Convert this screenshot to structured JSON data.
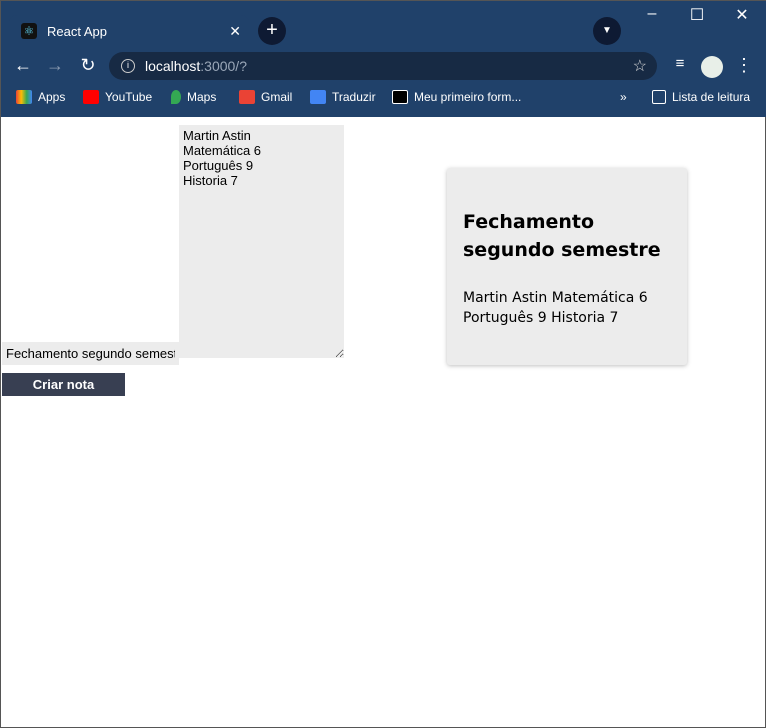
{
  "browser": {
    "tab_title": "React App",
    "url_host": "localhost",
    "url_rest": ":3000/?",
    "bookmarks": [
      {
        "label": "Apps",
        "color": "#ea4335"
      },
      {
        "label": "YouTube",
        "color": "#ff0000"
      },
      {
        "label": "Maps",
        "color": "#34a853"
      },
      {
        "label": "Gmail",
        "color": "#ea4335"
      },
      {
        "label": "Traduzir",
        "color": "#4285f4"
      },
      {
        "label": "Meu primeiro form...",
        "color": "#000000"
      }
    ],
    "reading_list": "Lista de leitura"
  },
  "form": {
    "title_value": "Fechamento segundo semestre",
    "text_value": "Martin Astin\nMatemática 6\nPortuguês 9\nHistoria 7",
    "submit_label": "Criar nota"
  },
  "note": {
    "title": "Fechamento segundo semestre",
    "text": "Martin Astin Matemática 6 Português 9 Historia 7"
  }
}
